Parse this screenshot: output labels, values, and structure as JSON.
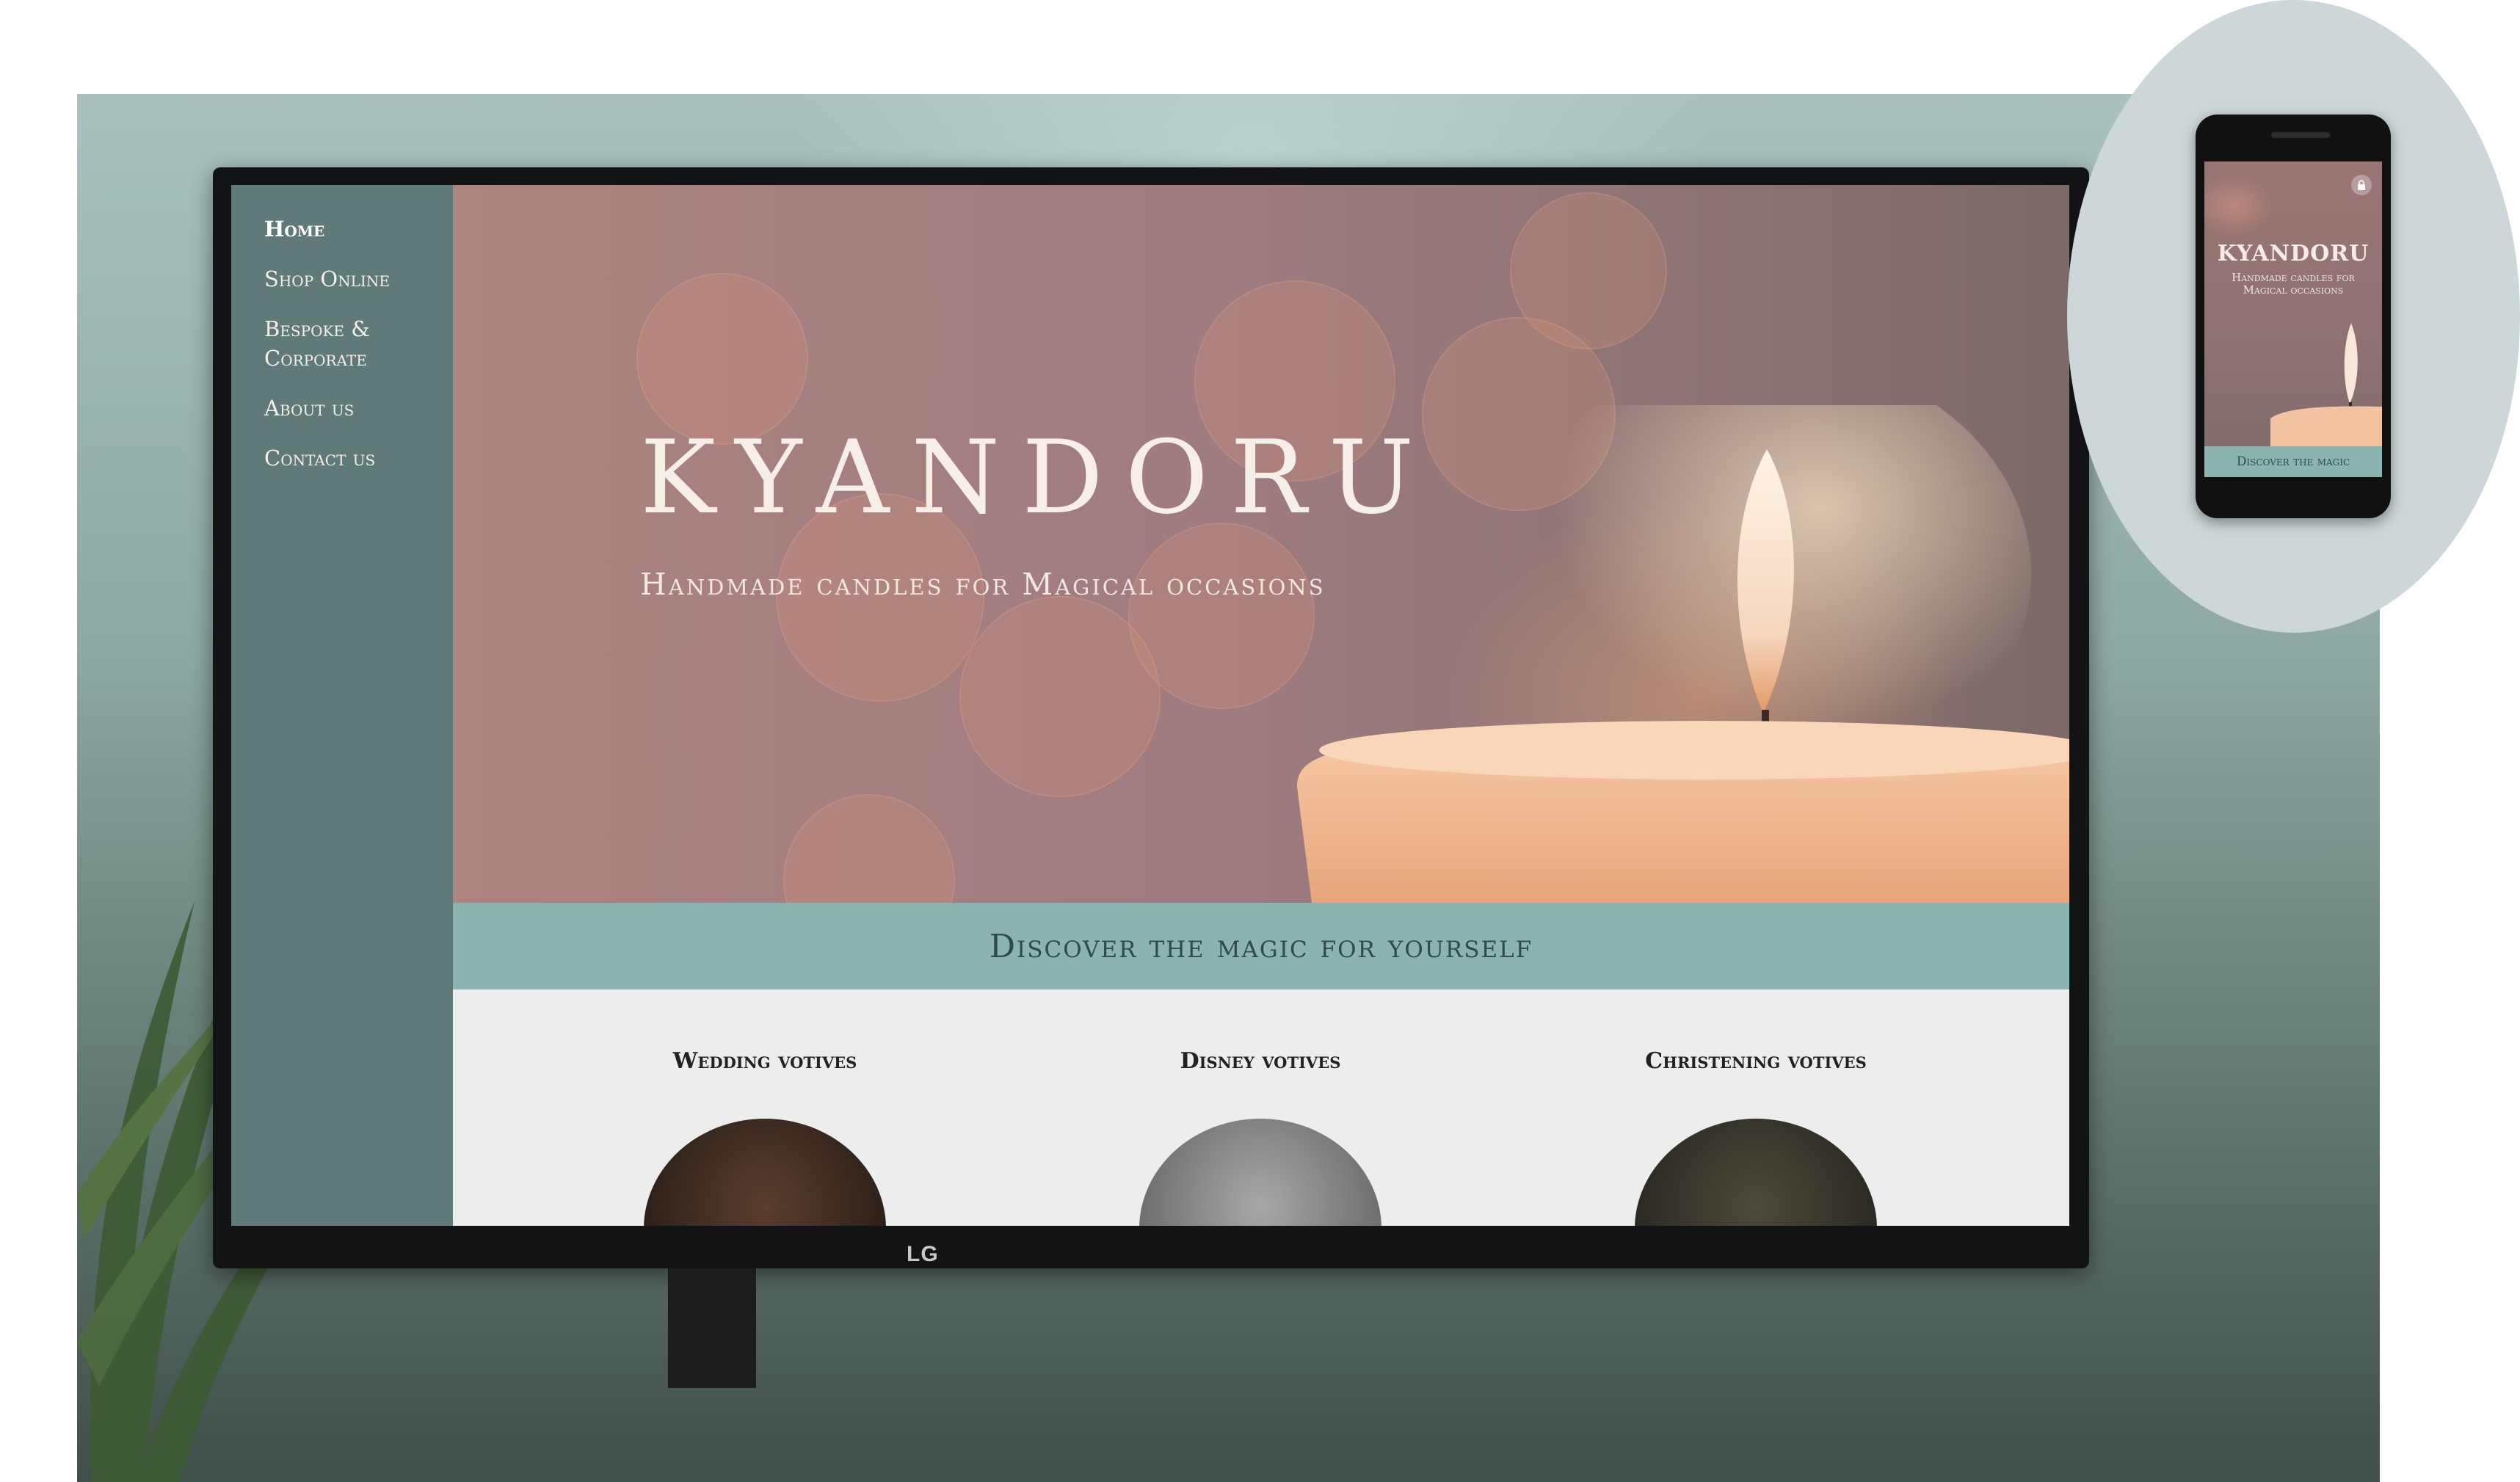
{
  "sidebar": {
    "items": [
      {
        "label": "Home",
        "active": true
      },
      {
        "label": "Shop Online",
        "active": false
      },
      {
        "label": "Bespoke & Corporate",
        "active": false
      },
      {
        "label": "About us",
        "active": false
      },
      {
        "label": "Contact us",
        "active": false
      }
    ]
  },
  "hero": {
    "title": "KYANDORU",
    "subtitle": "Handmade candles for Magical occasions"
  },
  "banner": {
    "text": "Discover the magic for yourself"
  },
  "products": [
    {
      "title": "Wedding votives"
    },
    {
      "title": "Disney votives"
    },
    {
      "title": "Christening votives"
    }
  ],
  "monitor": {
    "brand": "LG"
  },
  "mobile": {
    "title": "KYANDORU",
    "subtitle": "Handmade candles for Magical occasions",
    "cta": "Discover the magic"
  },
  "colors": {
    "sidebar": "#5f7a78",
    "banner": "#8bb3b0",
    "hero": "#a07c80",
    "background": "#ededed"
  },
  "icons": {
    "mobile_header": "lock-icon"
  }
}
